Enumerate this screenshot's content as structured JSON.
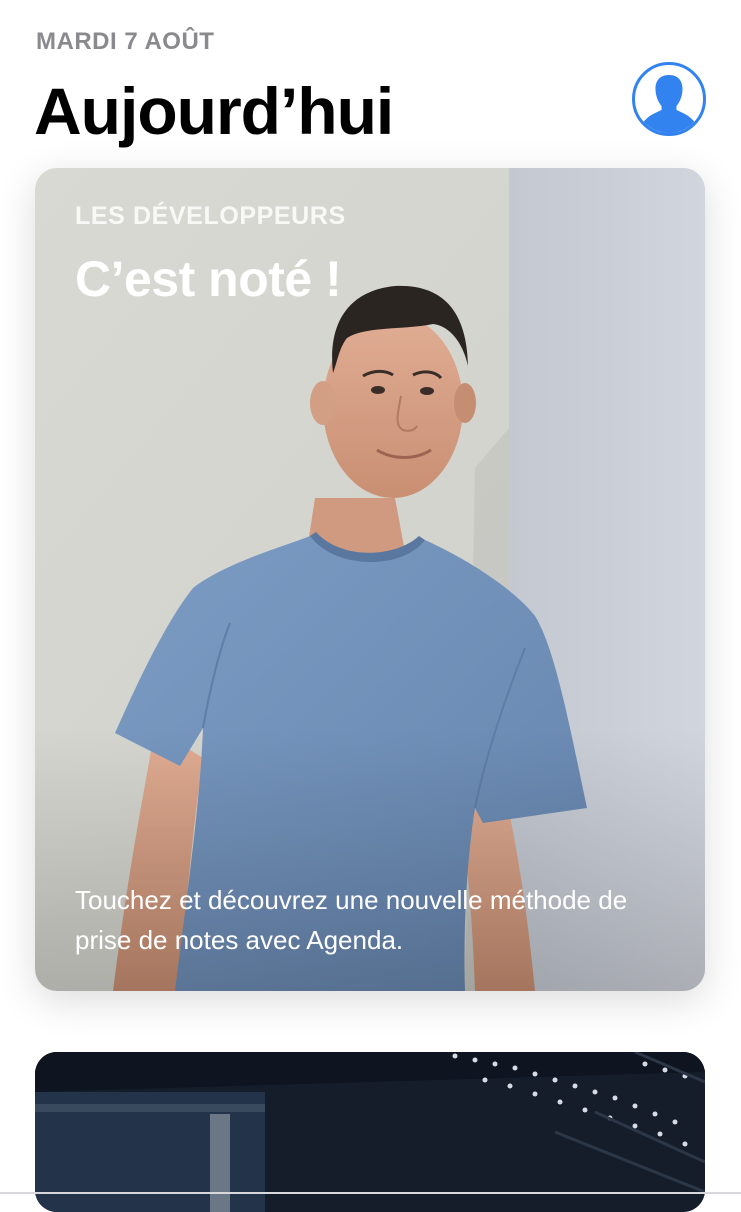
{
  "header": {
    "date": "MARDI 7 AOÛT",
    "title": "Aujourd’hui"
  },
  "colors": {
    "accent": "#3283ef",
    "date_gray": "#8a8a8e"
  },
  "icons": {
    "account": "person-silhouette-icon"
  },
  "featured_card": {
    "eyebrow": "LES DÉVELOPPEURS",
    "title": "C’est noté !",
    "description": "Touchez et découvrez une nouvelle méthode de prise de notes avec Agenda."
  }
}
